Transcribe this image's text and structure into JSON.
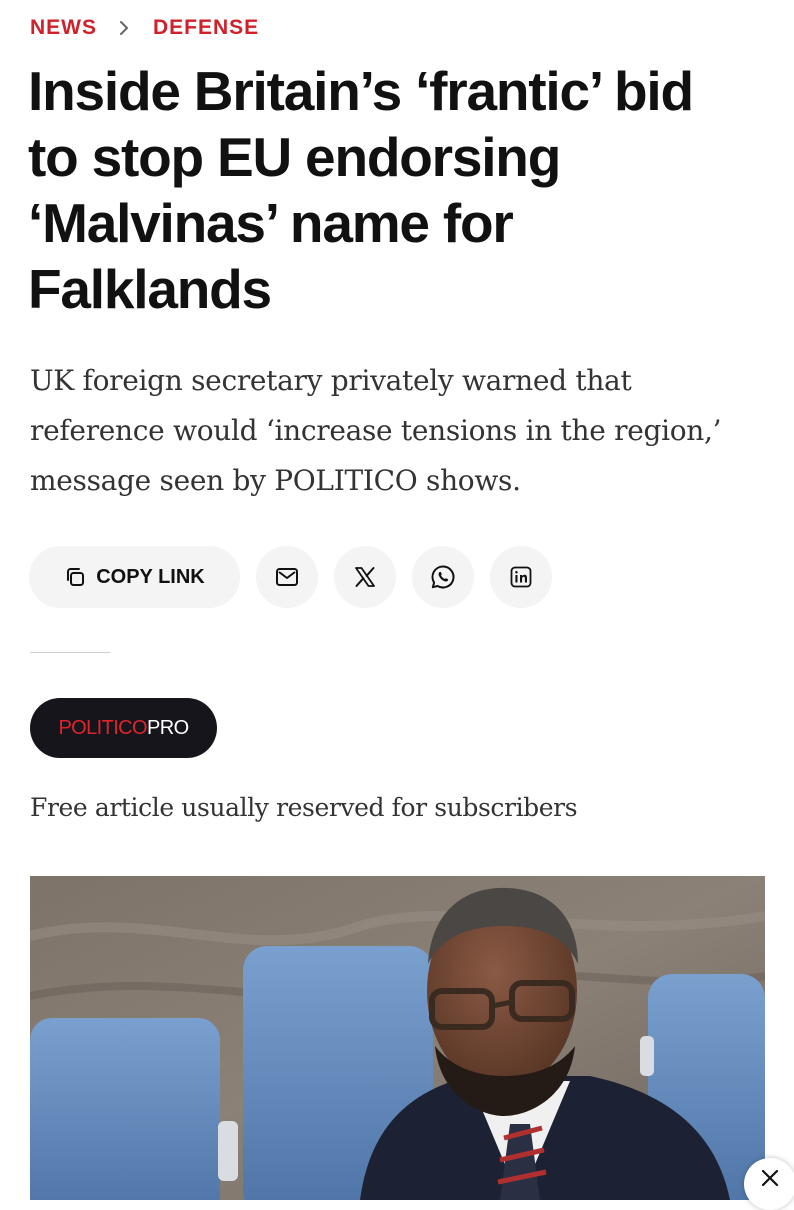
{
  "breadcrumb": {
    "section": "NEWS",
    "subsection": "DEFENSE",
    "separator_icon": "chevron-right-icon"
  },
  "article": {
    "headline_lines": [
      "Inside Britain’s ‘frantic’ bid",
      "to stop EU endorsing",
      "‘Malvinas’ name for",
      "Falklands"
    ],
    "dek_lines": [
      "UK foreign secretary privately warned that",
      "reference would ‘increase tensions in the region,’",
      "message seen by POLITICO shows."
    ],
    "free_note": "Free article usually reserved for subscribers"
  },
  "share": {
    "copy_link_label": "COPY LINK",
    "icons": [
      "copy-icon",
      "mail-icon",
      "x-icon",
      "whatsapp-icon",
      "linkedin-icon"
    ]
  },
  "badge": {
    "politico": "POLITICO",
    "pro": "PRO"
  },
  "photo": {
    "subject": "man in glasses and suit seated in blue chairs",
    "close_icon": "close-icon"
  },
  "colors": {
    "accent_red": "#d0202a",
    "badge_bg": "#15151b",
    "button_bg": "#f4f4f4",
    "chair_blue": "#5f86b8"
  }
}
